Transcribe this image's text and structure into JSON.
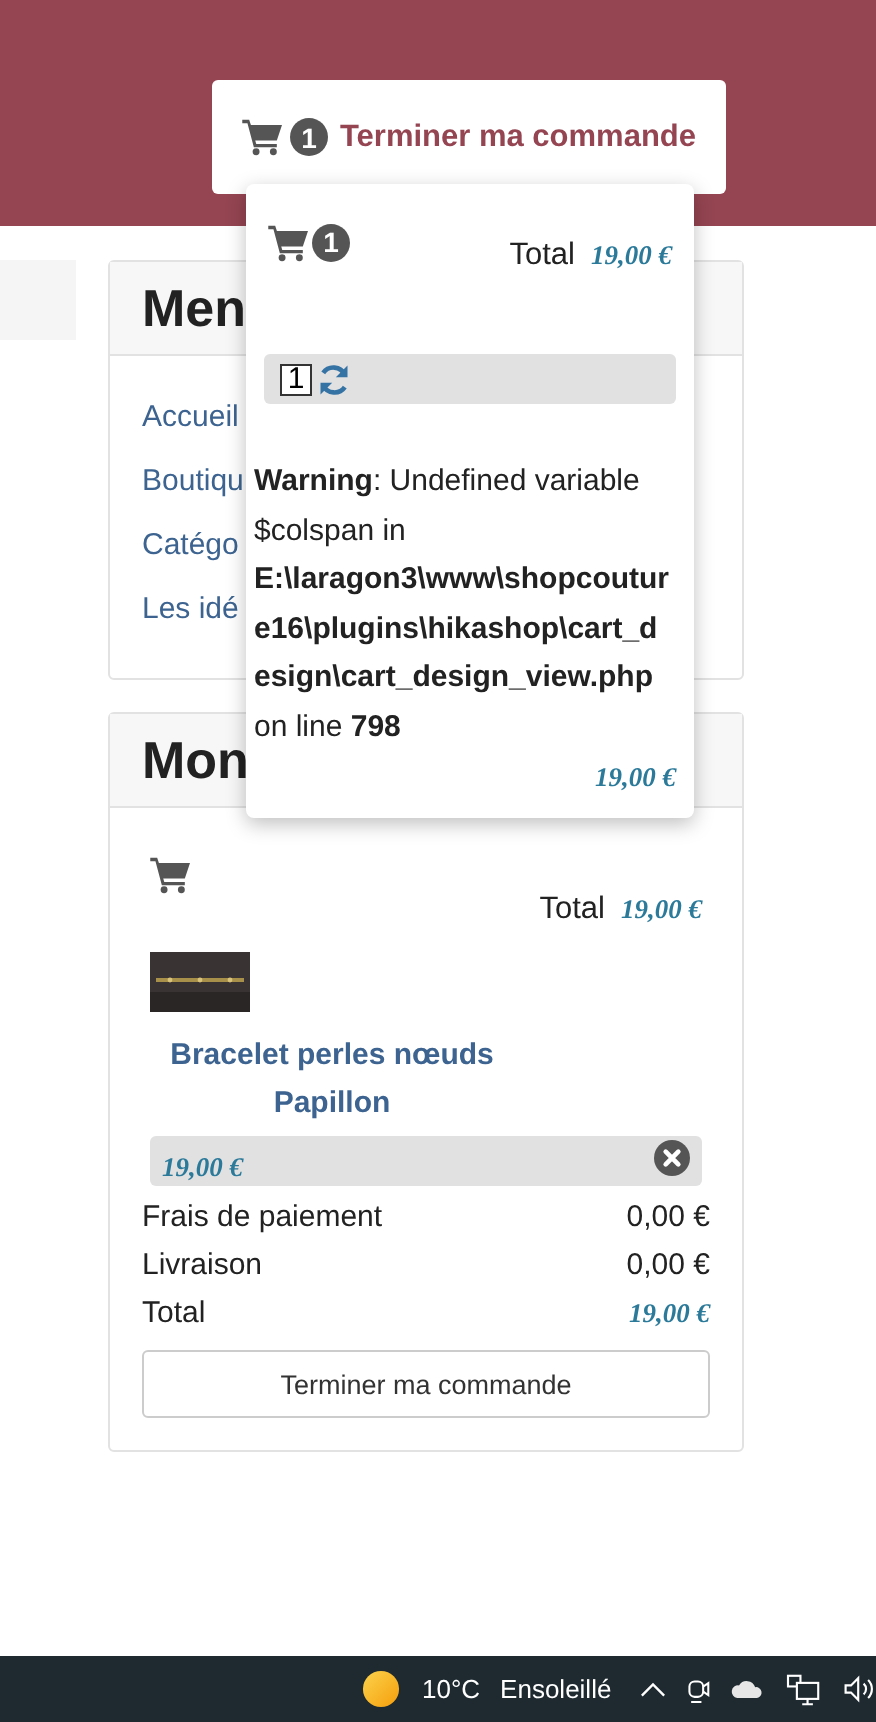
{
  "header": {
    "cart_button": {
      "count": "1",
      "label": "Terminer ma commande"
    }
  },
  "cart_popover": {
    "count": "1",
    "total_label": "Total",
    "total": "19,00 €",
    "quantity": "1",
    "warning": "**Warning**: Undefined variable $colspan in **E:\\laragon3\\www\\shopcouture16\\plugins\\hikashop\\cart_design\\cart_design_view.php** on line **798**",
    "price": "19,00 €"
  },
  "modules": [
    {
      "kind": "menu",
      "title": "Men",
      "links": [
        "Accueil",
        "Boutiqu",
        "Catégo",
        "Les idé"
      ]
    },
    {
      "kind": "cart",
      "title": "Mon",
      "total_label": "Total",
      "total": "19,00 €",
      "product": {
        "name": "Bracelet perles nœuds Papillon",
        "price": "19,00 €"
      },
      "summary": [
        {
          "kind": "plain",
          "label": "Frais de paiement",
          "value": "0,00 €"
        },
        {
          "kind": "plain",
          "label": "Livraison",
          "value": "0,00 €"
        },
        {
          "kind": "total",
          "label": "Total",
          "value": "19,00 €"
        }
      ],
      "button": "Terminer ma commande"
    }
  ],
  "taskbar": {
    "temperature": "10°C",
    "weather": "Ensoleillé"
  }
}
